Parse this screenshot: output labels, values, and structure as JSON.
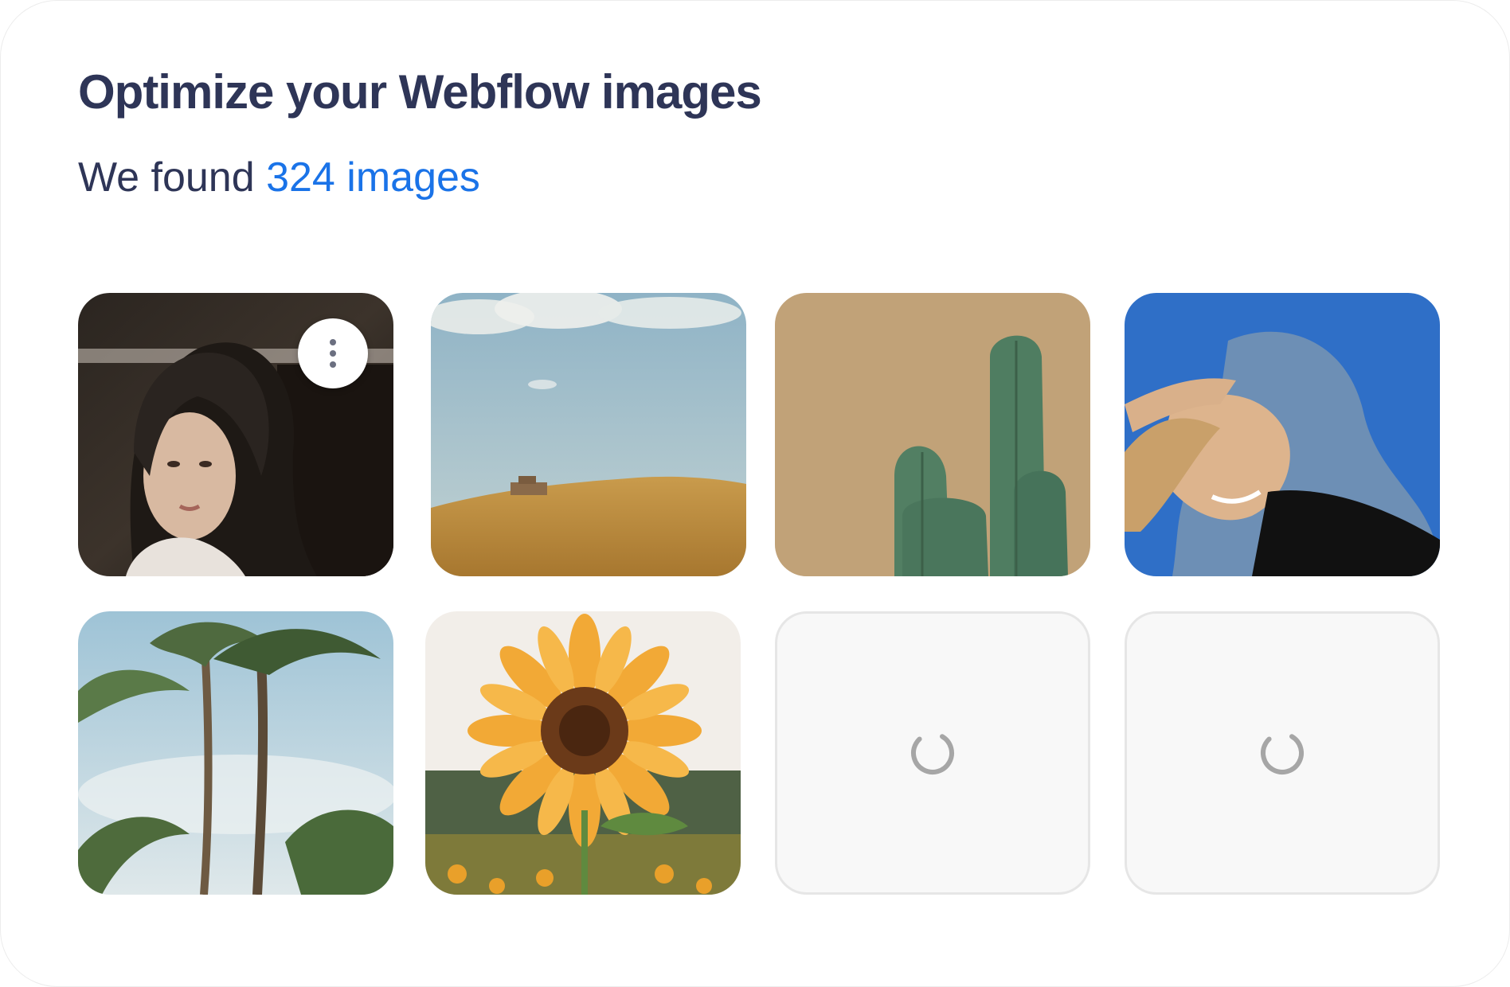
{
  "header": {
    "title": "Optimize your Webflow images",
    "subtitle_prefix": "We found ",
    "subtitle_count": "324 images"
  },
  "colors": {
    "title": "#2e3557",
    "accent": "#1a73e8",
    "placeholder_bg": "#f8f8f8"
  },
  "gallery": {
    "images": [
      {
        "subject": "woman-portrait",
        "has_menu": true
      },
      {
        "subject": "hill-landscape"
      },
      {
        "subject": "cactus"
      },
      {
        "subject": "woman-denim-jacket"
      },
      {
        "subject": "palm-trees"
      },
      {
        "subject": "sunflower"
      }
    ],
    "loading_tiles": 2,
    "menu_icon": "more-vertical-icon",
    "spinner_icon": "loading-spinner-icon"
  }
}
